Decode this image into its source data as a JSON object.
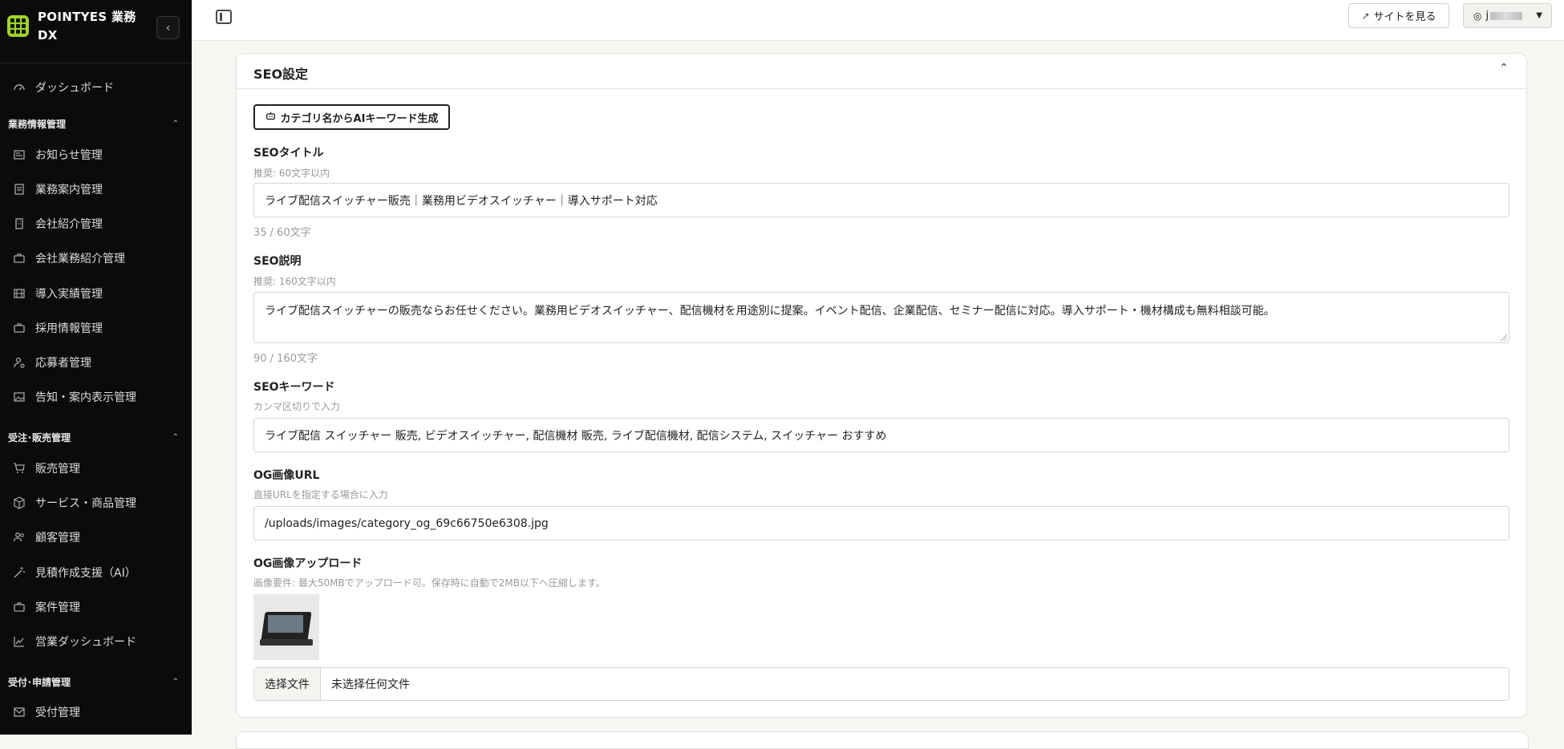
{
  "brand": {
    "name": "POINTYES 業務DX"
  },
  "sidebar": {
    "dashboard": "ダッシュボード",
    "sections": [
      {
        "title": "業務情報管理",
        "items": [
          "お知らせ管理",
          "業務案内管理",
          "会社紹介管理",
          "会社業務紹介管理",
          "導入実績管理",
          "採用情報管理",
          "応募者管理",
          "告知・案内表示管理"
        ]
      },
      {
        "title": "受注･販売管理",
        "items": [
          "販売管理",
          "サービス・商品管理",
          "顧客管理",
          "見積作成支援（AI）",
          "案件管理",
          "営業ダッシュボード"
        ]
      },
      {
        "title": "受付･申請管理",
        "items": [
          "受付管理"
        ]
      }
    ]
  },
  "topbar": {
    "site_label": "サイトを見る",
    "user_label": "j"
  },
  "seo": {
    "section_title": "SEO設定",
    "ai_button": "カテゴリ名からAIキーワード生成",
    "title_label": "SEOタイトル",
    "title_hint": "推奨: 60文字以内",
    "title_value": "ライブ配信スイッチャー販売｜業務用ビデオスイッチャー｜導入サポート対応",
    "title_count": "35 / 60文字",
    "desc_label": "SEO説明",
    "desc_hint": "推奨: 160文字以内",
    "desc_value": "ライブ配信スイッチャーの販売ならお任せください。業務用ビデオスイッチャー、配信機材を用途別に提案。イベント配信、企業配信、セミナー配信に対応。導入サポート・機材構成も無料相談可能。",
    "desc_count": "90 / 160文字",
    "kw_label": "SEOキーワード",
    "kw_hint": "カンマ区切りで入力",
    "kw_value": "ライブ配信 スイッチャー 販売, ビデオスイッチャー, 配信機材 販売, ライブ配信機材, 配信システム, スイッチャー おすすめ",
    "og_url_label": "OG画像URL",
    "og_url_hint": "直接URLを指定する場合に入力",
    "og_url_value": "/uploads/images/category_og_69c66750e6308.jpg",
    "og_upload_label": "OG画像アップロード",
    "og_upload_hint": "画像要件: 最大50MBでアップロード可。保存時に自動で2MB以下へ圧縮します。",
    "file_button": "选择文件",
    "file_status": "未选择任何文件"
  }
}
